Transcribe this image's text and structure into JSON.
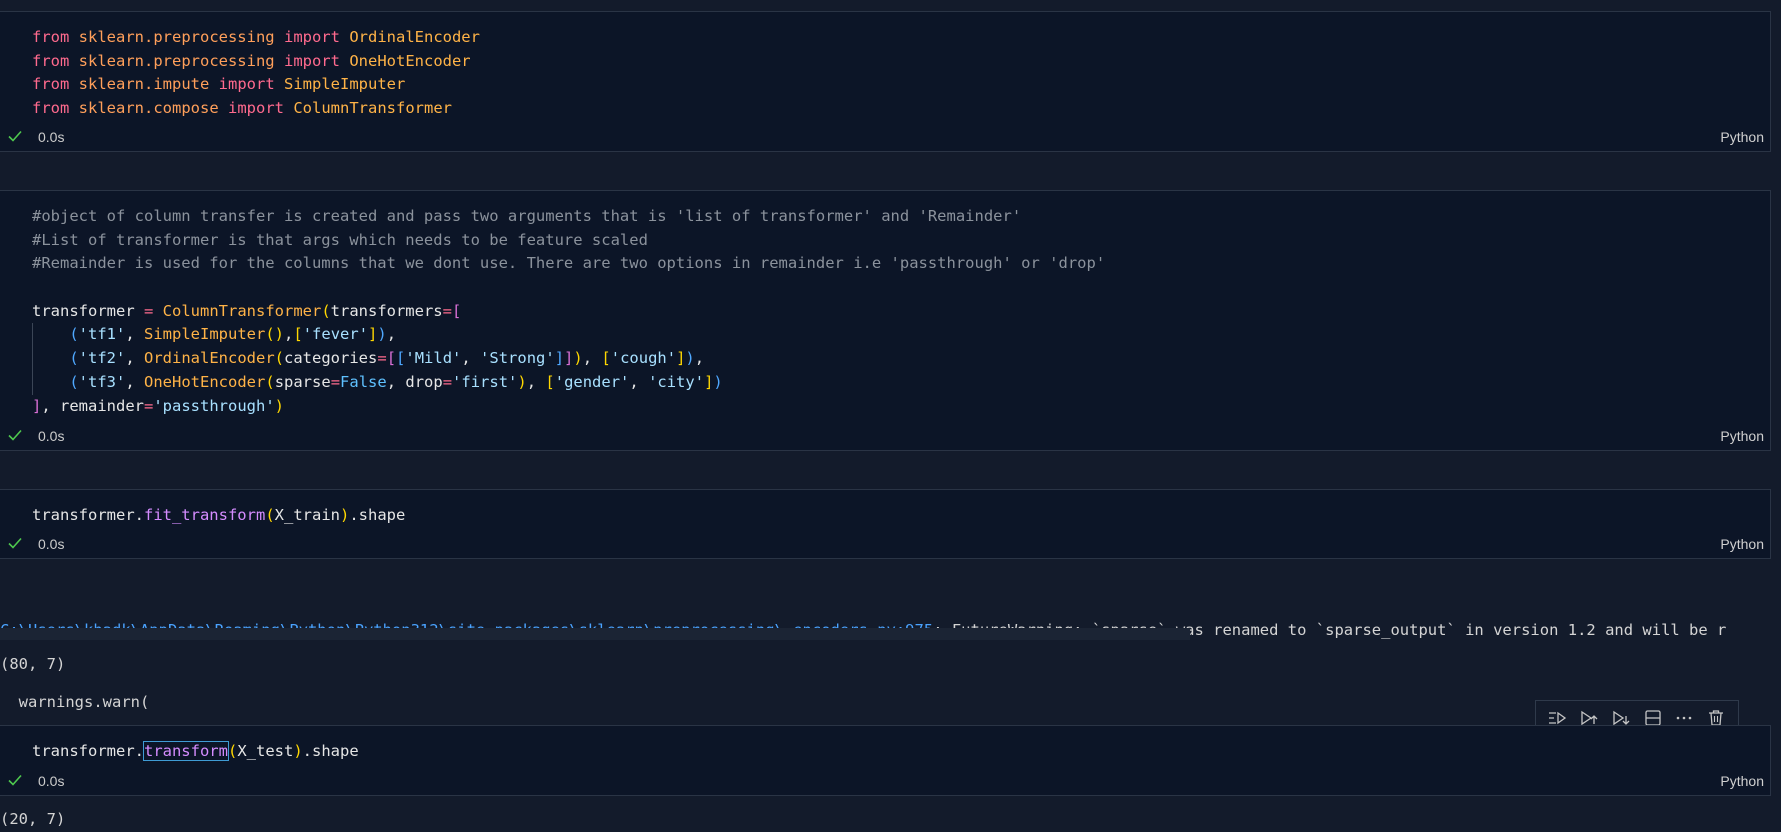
{
  "cells": [
    {
      "time": "0.0s",
      "language": "Python",
      "lines": [
        [
          [
            "k",
            "from"
          ],
          [
            "v",
            " "
          ],
          [
            "mod",
            "sklearn.preprocessing"
          ],
          [
            "v",
            " "
          ],
          [
            "k",
            "import"
          ],
          [
            "v",
            " "
          ],
          [
            "cls",
            "OrdinalEncoder"
          ]
        ],
        [
          [
            "k",
            "from"
          ],
          [
            "v",
            " "
          ],
          [
            "mod",
            "sklearn.preprocessing"
          ],
          [
            "v",
            " "
          ],
          [
            "k",
            "import"
          ],
          [
            "v",
            " "
          ],
          [
            "cls",
            "OneHotEncoder"
          ]
        ],
        [
          [
            "k",
            "from"
          ],
          [
            "v",
            " "
          ],
          [
            "mod",
            "sklearn.impute"
          ],
          [
            "v",
            " "
          ],
          [
            "k",
            "import"
          ],
          [
            "v",
            " "
          ],
          [
            "cls",
            "SimpleImputer"
          ]
        ],
        [
          [
            "k",
            "from"
          ],
          [
            "v",
            " "
          ],
          [
            "mod",
            "sklearn.compose"
          ],
          [
            "v",
            " "
          ],
          [
            "k",
            "import"
          ],
          [
            "v",
            " "
          ],
          [
            "cls",
            "ColumnTransformer"
          ]
        ]
      ]
    },
    {
      "time": "0.0s",
      "language": "Python",
      "lines": [
        [
          [
            "cm",
            "#object of column transfer is created and pass two arguments that is 'list of transformer' and 'Remainder'"
          ]
        ],
        [
          [
            "cm",
            "#List of transformer is that args which needs to be feature scaled"
          ]
        ],
        [
          [
            "cm",
            "#Remainder is used for the columns that we dont use. There are two options in remainder i.e 'passthrough' or 'drop'"
          ]
        ],
        [],
        [
          [
            "v",
            "transformer "
          ],
          [
            "op",
            "="
          ],
          [
            "v",
            " "
          ],
          [
            "cls",
            "ColumnTransformer"
          ],
          [
            "b1",
            "("
          ],
          [
            "v",
            "transformers"
          ],
          [
            "op",
            "="
          ],
          [
            "b2",
            "["
          ]
        ],
        [
          [
            "v",
            "    "
          ],
          [
            "b3",
            "("
          ],
          [
            "s",
            "'tf1'"
          ],
          [
            "v",
            ", "
          ],
          [
            "cls",
            "SimpleImputer"
          ],
          [
            "b1",
            "()"
          ],
          [
            "v",
            ","
          ],
          [
            "b1",
            "["
          ],
          [
            "s",
            "'fever'"
          ],
          [
            "b1",
            "]"
          ],
          [
            "b3",
            ")"
          ],
          [
            "v",
            ","
          ]
        ],
        [
          [
            "v",
            "    "
          ],
          [
            "b3",
            "("
          ],
          [
            "s",
            "'tf2'"
          ],
          [
            "v",
            ", "
          ],
          [
            "cls",
            "OrdinalEncoder"
          ],
          [
            "b1",
            "("
          ],
          [
            "v",
            "categories"
          ],
          [
            "op",
            "="
          ],
          [
            "b2",
            "["
          ],
          [
            "b3",
            "["
          ],
          [
            "s",
            "'Mild'"
          ],
          [
            "v",
            ", "
          ],
          [
            "s",
            "'Strong'"
          ],
          [
            "b3",
            "]"
          ],
          [
            "b2",
            "]"
          ],
          [
            "b1",
            ")"
          ],
          [
            "v",
            ", "
          ],
          [
            "b1",
            "["
          ],
          [
            "s",
            "'cough'"
          ],
          [
            "b1",
            "]"
          ],
          [
            "b3",
            ")"
          ],
          [
            "v",
            ","
          ]
        ],
        [
          [
            "v",
            "    "
          ],
          [
            "b3",
            "("
          ],
          [
            "s",
            "'tf3'"
          ],
          [
            "v",
            ", "
          ],
          [
            "cls",
            "OneHotEncoder"
          ],
          [
            "b1",
            "("
          ],
          [
            "v",
            "sparse"
          ],
          [
            "op",
            "="
          ],
          [
            "kw",
            "False"
          ],
          [
            "v",
            ", drop"
          ],
          [
            "op",
            "="
          ],
          [
            "s",
            "'first'"
          ],
          [
            "b1",
            ")"
          ],
          [
            "v",
            ", "
          ],
          [
            "b1",
            "["
          ],
          [
            "s",
            "'gender'"
          ],
          [
            "v",
            ", "
          ],
          [
            "s",
            "'city'"
          ],
          [
            "b1",
            "]"
          ],
          [
            "b3",
            ")"
          ]
        ],
        [
          [
            "b2",
            "]"
          ],
          [
            "v",
            ", remainder"
          ],
          [
            "op",
            "="
          ],
          [
            "s",
            "'passthrough'"
          ],
          [
            "b1",
            ")"
          ]
        ]
      ]
    },
    {
      "time": "0.0s",
      "language": "Python",
      "lines": [
        [
          [
            "v",
            "transformer."
          ],
          [
            "fn",
            "fit_transform"
          ],
          [
            "b1",
            "("
          ],
          [
            "v",
            "X_train"
          ],
          [
            "b1",
            ")"
          ],
          [
            "v",
            ".shape"
          ]
        ]
      ]
    },
    {
      "time": "0.0s",
      "language": "Python",
      "lines": [
        [
          [
            "v",
            "transformer."
          ],
          [
            "fn",
            "transform"
          ],
          [
            "b1",
            "("
          ],
          [
            "v",
            "X_test"
          ],
          [
            "b1",
            ")"
          ],
          [
            "v",
            ".shape"
          ]
        ]
      ]
    }
  ],
  "warning": {
    "path": "C:\\Users\\khadk\\AppData\\Roaming\\Python\\Python312\\site-packages\\sklearn\\preprocessing\\_encoders.py:975",
    "message": ": FutureWarning: `sparse` was renamed to `sparse_output` in version 1.2 and will be r",
    "second_line": "  warnings.warn("
  },
  "outputs": {
    "train_shape": "(80, 7)",
    "test_shape": "(20, 7)"
  },
  "toolbar": {
    "icons": [
      "execute-above-cells-icon",
      "run-above-icon",
      "run-below-icon",
      "split-cell-icon",
      "more-actions-icon",
      "delete-cell-icon"
    ]
  },
  "colors": {
    "background": "#131b2b",
    "cell_background": "#0c1527",
    "success_check": "#4ec94e",
    "link": "#4aa3ff"
  }
}
